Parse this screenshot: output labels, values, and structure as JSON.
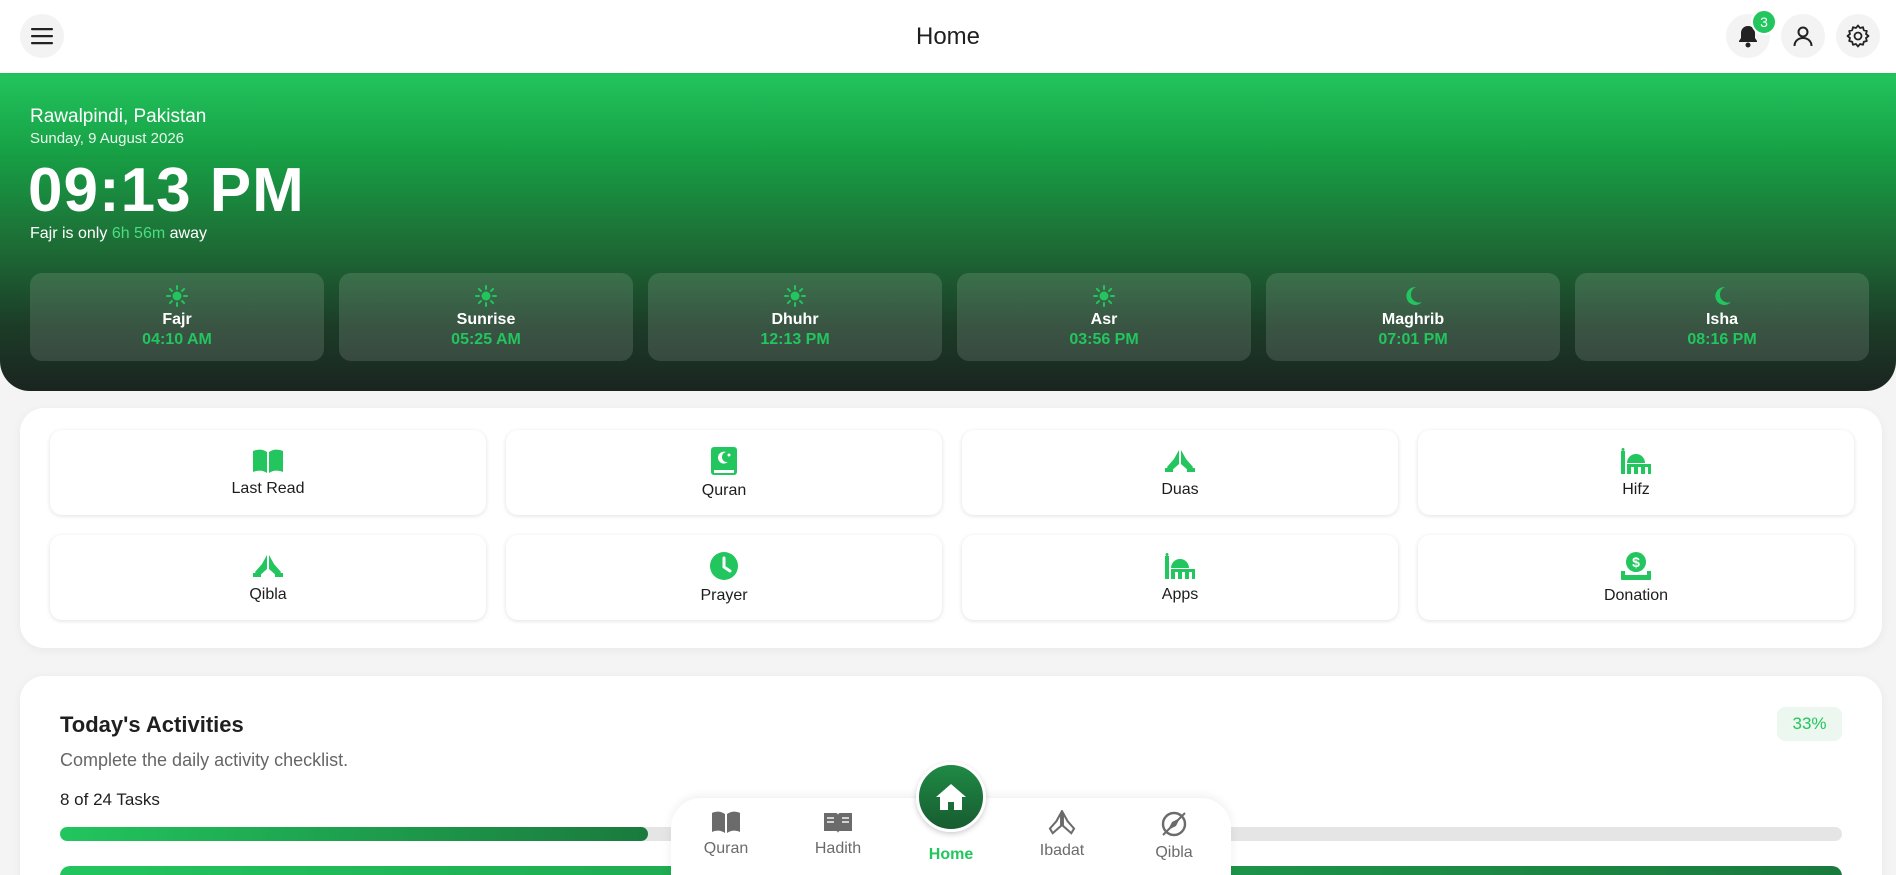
{
  "header": {
    "title": "Home",
    "notification_count": "3"
  },
  "hero": {
    "location": "Rawalpindi, Pakistan",
    "date": "Sunday, 9 August 2026",
    "clock": "09:13 PM",
    "next_prefix": "Fajr is only",
    "next_remaining": "6h 56m",
    "next_suffix": "away",
    "prayers": [
      {
        "name": "Fajr",
        "time": "04:10 AM",
        "icon": "sun-icon"
      },
      {
        "name": "Sunrise",
        "time": "05:25 AM",
        "icon": "sun-icon"
      },
      {
        "name": "Dhuhr",
        "time": "12:13 PM",
        "icon": "sun-icon"
      },
      {
        "name": "Asr",
        "time": "03:56 PM",
        "icon": "sun-icon"
      },
      {
        "name": "Maghrib",
        "time": "07:01 PM",
        "icon": "moon-icon"
      },
      {
        "name": "Isha",
        "time": "08:16 PM",
        "icon": "moon-icon"
      }
    ]
  },
  "quick_actions": [
    {
      "label": "Last Read",
      "icon": "open-book-icon"
    },
    {
      "label": "Quran",
      "icon": "quran-icon"
    },
    {
      "label": "Duas",
      "icon": "praying-hands-icon"
    },
    {
      "label": "Hifz",
      "icon": "mosque-icon"
    },
    {
      "label": "Qibla",
      "icon": "praying-hands-icon"
    },
    {
      "label": "Prayer",
      "icon": "clock-icon"
    },
    {
      "label": "Apps",
      "icon": "mosque-icon"
    },
    {
      "label": "Donation",
      "icon": "donation-icon"
    }
  ],
  "activities": {
    "title": "Today's Activities",
    "subtitle": "Complete the daily activity checklist.",
    "tasks": "8 of 24 Tasks",
    "percent": "33%",
    "progress_fraction": 0.33
  },
  "bottom_nav": [
    {
      "label": "Quran",
      "icon": "open-book-icon"
    },
    {
      "label": "Hadith",
      "icon": "book-icon"
    },
    {
      "label": "Home",
      "icon": "home-icon"
    },
    {
      "label": "Ibadat",
      "icon": "praying-hands-icon"
    },
    {
      "label": "Qibla",
      "icon": "compass-icon"
    }
  ],
  "colors": {
    "accent": "#22c55e",
    "dark_green": "#1a2520"
  }
}
